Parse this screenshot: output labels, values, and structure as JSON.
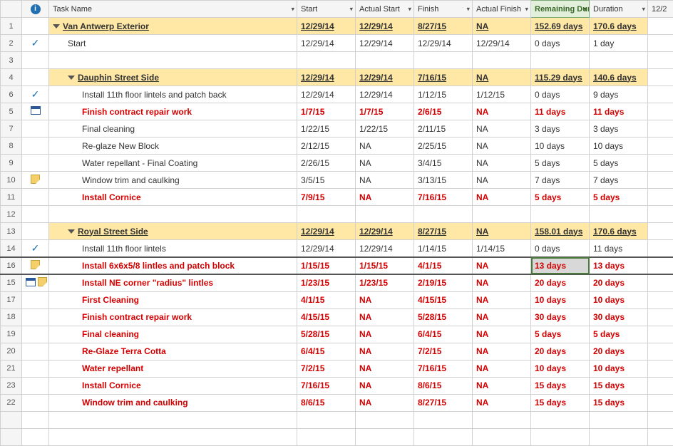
{
  "columns": {
    "rownum": "",
    "indicator": "i",
    "task_name": "Task Name",
    "start": "Start",
    "actual_start": "Actual Start",
    "finish": "Finish",
    "actual_finish": "Actual Finish",
    "remaining_duration": "Remaining Duration",
    "duration": "Duration",
    "timeline": "12/2"
  },
  "rows": [
    {
      "num": "1",
      "ind": [],
      "indent": 0,
      "summary": true,
      "critical": false,
      "tri": true,
      "name": "Van Antwerp Exterior",
      "start": "12/29/14",
      "astart": "12/29/14",
      "finish": "8/27/15",
      "afinish": "NA",
      "rdur": "152.69 days",
      "dur": "170.6 days"
    },
    {
      "num": "2",
      "ind": [
        "check"
      ],
      "indent": 1,
      "summary": false,
      "critical": false,
      "tri": false,
      "name": "Start",
      "start": "12/29/14",
      "astart": "12/29/14",
      "finish": "12/29/14",
      "afinish": "12/29/14",
      "rdur": "0 days",
      "dur": "1 day"
    },
    {
      "num": "3",
      "ind": [],
      "indent": 0,
      "summary": false,
      "critical": false,
      "tri": false,
      "name": "",
      "start": "",
      "astart": "",
      "finish": "",
      "afinish": "",
      "rdur": "",
      "dur": ""
    },
    {
      "num": "4",
      "ind": [],
      "indent": 1,
      "summary": true,
      "critical": false,
      "tri": true,
      "name": "Dauphin Street Side",
      "start": "12/29/14",
      "astart": "12/29/14",
      "finish": "7/16/15",
      "afinish": "NA",
      "rdur": "115.29 days",
      "dur": "140.6 days"
    },
    {
      "num": "6",
      "ind": [
        "check"
      ],
      "indent": 2,
      "summary": false,
      "critical": false,
      "tri": false,
      "name": "Install 11th floor lintels and patch back",
      "start": "12/29/14",
      "astart": "12/29/14",
      "finish": "1/12/15",
      "afinish": "1/12/15",
      "rdur": "0 days",
      "dur": "9 days"
    },
    {
      "num": "5",
      "ind": [
        "cal"
      ],
      "indent": 2,
      "summary": false,
      "critical": true,
      "tri": false,
      "name": "Finish contract repair work",
      "start": "1/7/15",
      "astart": "1/7/15",
      "finish": "2/6/15",
      "afinish": "NA",
      "rdur": "11 days",
      "dur": "11 days"
    },
    {
      "num": "7",
      "ind": [],
      "indent": 2,
      "summary": false,
      "critical": false,
      "tri": false,
      "name": "Final cleaning",
      "start": "1/22/15",
      "astart": "1/22/15",
      "finish": "2/11/15",
      "afinish": "NA",
      "rdur": "3 days",
      "dur": "3 days"
    },
    {
      "num": "8",
      "ind": [],
      "indent": 2,
      "summary": false,
      "critical": false,
      "tri": false,
      "name": "Re-glaze New Block",
      "start": "2/12/15",
      "astart": "NA",
      "finish": "2/25/15",
      "afinish": "NA",
      "rdur": "10 days",
      "dur": "10 days"
    },
    {
      "num": "9",
      "ind": [],
      "indent": 2,
      "summary": false,
      "critical": false,
      "tri": false,
      "name": "Water repellant - Final Coating",
      "start": "2/26/15",
      "astart": "NA",
      "finish": "3/4/15",
      "afinish": "NA",
      "rdur": "5 days",
      "dur": "5 days"
    },
    {
      "num": "10",
      "ind": [
        "note"
      ],
      "indent": 2,
      "summary": false,
      "critical": false,
      "tri": false,
      "name": "Window trim and caulking",
      "start": "3/5/15",
      "astart": "NA",
      "finish": "3/13/15",
      "afinish": "NA",
      "rdur": "7 days",
      "dur": "7 days"
    },
    {
      "num": "11",
      "ind": [],
      "indent": 2,
      "summary": false,
      "critical": true,
      "tri": false,
      "name": "Install Cornice",
      "start": "7/9/15",
      "astart": "NA",
      "finish": "7/16/15",
      "afinish": "NA",
      "rdur": "5 days",
      "dur": "5 days"
    },
    {
      "num": "12",
      "ind": [],
      "indent": 0,
      "summary": false,
      "critical": false,
      "tri": false,
      "name": "",
      "start": "",
      "astart": "",
      "finish": "",
      "afinish": "",
      "rdur": "",
      "dur": ""
    },
    {
      "num": "13",
      "ind": [],
      "indent": 1,
      "summary": true,
      "critical": false,
      "tri": true,
      "name": "Royal Street Side",
      "start": "12/29/14",
      "astart": "12/29/14",
      "finish": "8/27/15",
      "afinish": "NA",
      "rdur": "158.01 days",
      "dur": "170.6 days"
    },
    {
      "num": "14",
      "ind": [
        "check"
      ],
      "indent": 2,
      "summary": false,
      "critical": false,
      "tri": false,
      "name": "Install 11th floor lintels",
      "start": "12/29/14",
      "astart": "12/29/14",
      "finish": "1/14/15",
      "afinish": "1/14/15",
      "rdur": "0 days",
      "dur": "11 days"
    },
    {
      "num": "16",
      "ind": [
        "note"
      ],
      "indent": 2,
      "summary": false,
      "critical": true,
      "tri": false,
      "name": "Install 6x6x5/8 lintles and patch block",
      "start": "1/15/15",
      "astart": "1/15/15",
      "finish": "4/1/15",
      "afinish": "NA",
      "rdur": "13 days",
      "dur": "13 days",
      "selected": true
    },
    {
      "num": "15",
      "ind": [
        "cal",
        "note"
      ],
      "indent": 2,
      "summary": false,
      "critical": true,
      "tri": false,
      "name": "Install NE corner \"radius\" lintles",
      "start": "1/23/15",
      "astart": "1/23/15",
      "finish": "2/19/15",
      "afinish": "NA",
      "rdur": "20 days",
      "dur": "20 days"
    },
    {
      "num": "17",
      "ind": [],
      "indent": 2,
      "summary": false,
      "critical": true,
      "tri": false,
      "name": "First Cleaning",
      "start": "4/1/15",
      "astart": "NA",
      "finish": "4/15/15",
      "afinish": "NA",
      "rdur": "10 days",
      "dur": "10 days"
    },
    {
      "num": "18",
      "ind": [],
      "indent": 2,
      "summary": false,
      "critical": true,
      "tri": false,
      "name": "Finish contract repair work",
      "start": "4/15/15",
      "astart": "NA",
      "finish": "5/28/15",
      "afinish": "NA",
      "rdur": "30 days",
      "dur": "30 days"
    },
    {
      "num": "19",
      "ind": [],
      "indent": 2,
      "summary": false,
      "critical": true,
      "tri": false,
      "name": "Final cleaning",
      "start": "5/28/15",
      "astart": "NA",
      "finish": "6/4/15",
      "afinish": "NA",
      "rdur": "5 days",
      "dur": "5 days"
    },
    {
      "num": "20",
      "ind": [],
      "indent": 2,
      "summary": false,
      "critical": true,
      "tri": false,
      "name": "Re-Glaze Terra Cotta",
      "start": "6/4/15",
      "astart": "NA",
      "finish": "7/2/15",
      "afinish": "NA",
      "rdur": "20 days",
      "dur": "20 days"
    },
    {
      "num": "21",
      "ind": [],
      "indent": 2,
      "summary": false,
      "critical": true,
      "tri": false,
      "name": "Water repellant",
      "start": "7/2/15",
      "astart": "NA",
      "finish": "7/16/15",
      "afinish": "NA",
      "rdur": "10 days",
      "dur": "10 days"
    },
    {
      "num": "23",
      "ind": [],
      "indent": 2,
      "summary": false,
      "critical": true,
      "tri": false,
      "name": "Install Cornice",
      "start": "7/16/15",
      "astart": "NA",
      "finish": "8/6/15",
      "afinish": "NA",
      "rdur": "15 days",
      "dur": "15 days"
    },
    {
      "num": "22",
      "ind": [],
      "indent": 2,
      "summary": false,
      "critical": true,
      "tri": false,
      "name": "Window trim and caulking",
      "start": "8/6/15",
      "astart": "NA",
      "finish": "8/27/15",
      "afinish": "NA",
      "rdur": "15 days",
      "dur": "15 days"
    },
    {
      "num": "",
      "ind": [],
      "indent": 0,
      "summary": false,
      "critical": false,
      "tri": false,
      "name": "",
      "start": "",
      "astart": "",
      "finish": "",
      "afinish": "",
      "rdur": "",
      "dur": ""
    },
    {
      "num": "",
      "ind": [],
      "indent": 0,
      "summary": false,
      "critical": false,
      "tri": false,
      "name": "",
      "start": "",
      "astart": "",
      "finish": "",
      "afinish": "",
      "rdur": "",
      "dur": ""
    }
  ]
}
